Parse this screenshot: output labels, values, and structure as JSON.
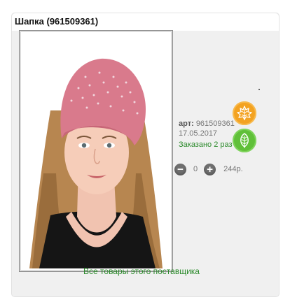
{
  "product": {
    "title": "Шапка (961509361)",
    "article_label": "арт:",
    "article": "961509361",
    "date": "17.05.2017",
    "ordered_text": "Заказано 2 раз"
  },
  "quantity": {
    "minus_symbol": "−",
    "plus_symbol": "+",
    "value": "0",
    "price": "244р."
  },
  "footer": {
    "supplier_link": "Все товары этого поставщика"
  },
  "icons": {
    "orange_button": "maple-leaf-icon",
    "green_button": "leaf-icon",
    "minus": "minus-circle-icon",
    "plus": "plus-circle-icon"
  },
  "colors": {
    "card_background": "#f0f0f0",
    "accent_green": "#2b8a2b",
    "orange_badge": "#f3a221",
    "green_badge": "#60c039",
    "hat_pink": "#d97a8c"
  }
}
